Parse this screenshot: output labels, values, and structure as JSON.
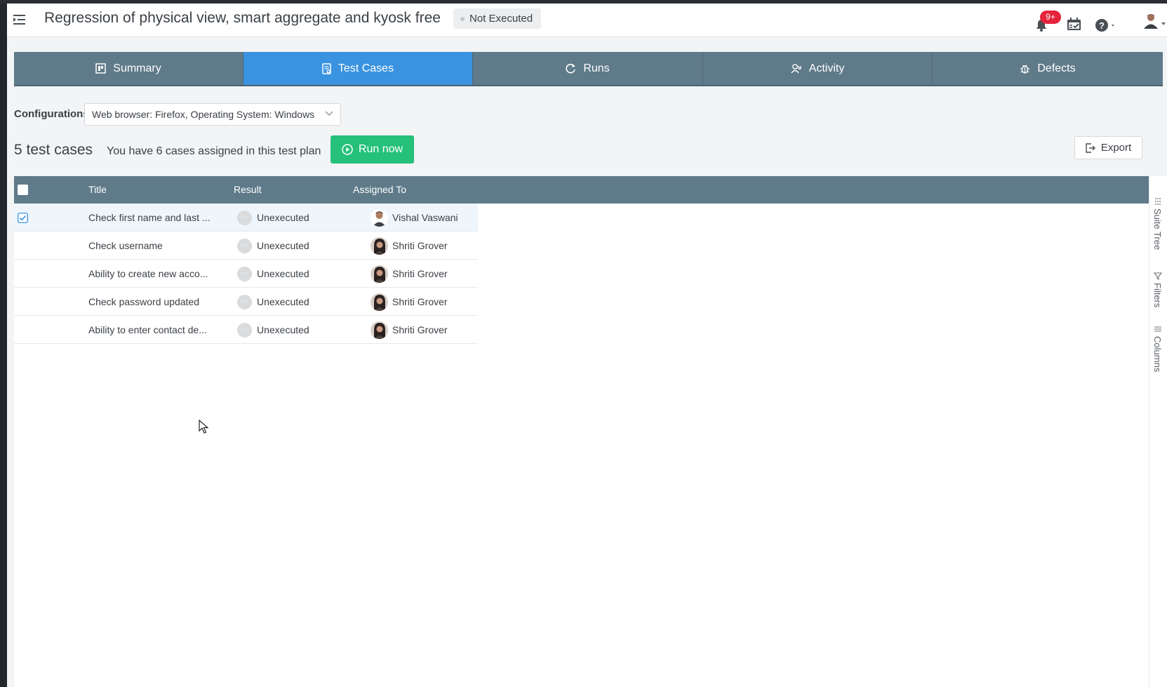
{
  "header": {
    "title": "Regression of physical view, smart aggregate and kyosk free",
    "status": "Not Executed",
    "notifications_badge": "9+",
    "icons": [
      "menu-icon",
      "bell-icon",
      "calendar-check-icon",
      "help-icon",
      "avatar"
    ]
  },
  "tabs": [
    {
      "label": "Summary",
      "icon": "summary-icon",
      "active": false
    },
    {
      "label": "Test Cases",
      "icon": "test-cases-icon",
      "active": true
    },
    {
      "label": "Runs",
      "icon": "runs-icon",
      "active": false
    },
    {
      "label": "Activity",
      "icon": "activity-icon",
      "active": false
    },
    {
      "label": "Defects",
      "icon": "bug-icon",
      "active": false
    }
  ],
  "configurations": {
    "label": "Configurations",
    "value": "Web browser: Firefox, Operating System: Windows"
  },
  "toolbar": {
    "count": "5 test cases",
    "assigned_text": "You have 6 cases assigned in this test plan",
    "run_now": "Run now",
    "export": "Export"
  },
  "grid": {
    "columns": {
      "title": "Title",
      "result": "Result",
      "assigned": "Assigned To"
    },
    "rows": [
      {
        "title": "Check first name and last ...",
        "result": "Unexecuted",
        "assigned": "Vishal Vaswani",
        "selected": true
      },
      {
        "title": "Check username",
        "result": "Unexecuted",
        "assigned": "Shriti Grover",
        "selected": false
      },
      {
        "title": "Ability to create new acco...",
        "result": "Unexecuted",
        "assigned": "Shriti Grover",
        "selected": false
      },
      {
        "title": "Check password updated",
        "result": "Unexecuted",
        "assigned": "Shriti Grover",
        "selected": false
      },
      {
        "title": "Ability to enter contact de...",
        "result": "Unexecuted",
        "assigned": "Shriti Grover",
        "selected": false
      }
    ]
  },
  "sidepanel": {
    "suite_tree": "Suite Tree",
    "filters": "Filters",
    "columns": "Columns"
  },
  "colors": {
    "tab_bar": "#5f7a89",
    "tab_active": "#3a93e0",
    "run_button": "#25c07a",
    "badge_red": "#e5243b"
  }
}
